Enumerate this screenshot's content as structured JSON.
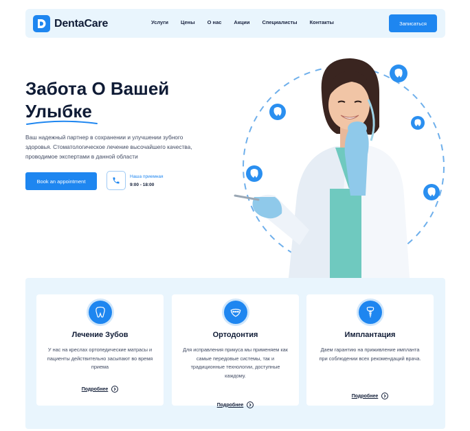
{
  "brand": {
    "name": "DentaCare",
    "accent": "#1e86f0",
    "dark": "#0f1b35",
    "light_bg": "#e9f5fd"
  },
  "nav": {
    "items": [
      "Услуги",
      "Цены",
      "О нас",
      "Акции",
      "Специалисты",
      "Контакты"
    ],
    "cta": "Записаться"
  },
  "hero": {
    "title_line1": "Забота О Вашей",
    "title_line2": "Улыбке",
    "description": "Ваш надежный партнер в сохранении и улучшении зубного здоровья. Стоматологическое лечение высочайшего качества, проводимое экспертами в данной области",
    "book_button": "Book an appointment",
    "reception_label": "Наша приемная",
    "reception_hours": "9:00 - 18:00"
  },
  "services": [
    {
      "icon": "tooth-icon",
      "title": "Лечение Зубов",
      "text": "У нас на креслах ортопедические матрасы и пациенты действительно засыпают во время приема",
      "link": "Подробнее"
    },
    {
      "icon": "braces-icon",
      "title": "Ортодонтия",
      "text": "Для исправления прикуса мы применяем как самые передовые системы, так и традиционные технологии, доступные каждому.",
      "link": "Подробнее"
    },
    {
      "icon": "implant-icon",
      "title": "Имплантация",
      "text": "Даем гарантию на приживление импланта при соблюдении всех рекомендаций врача.",
      "link": "Подробнее"
    }
  ]
}
